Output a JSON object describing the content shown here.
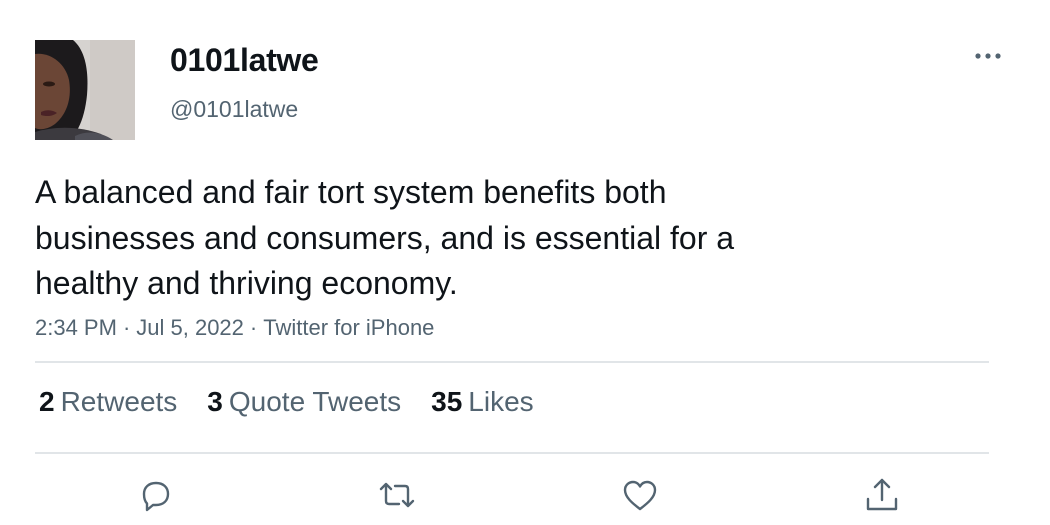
{
  "user": {
    "display_name": "0101latwe",
    "handle": "@0101latwe"
  },
  "tweet": {
    "text": "A balanced and fair tort system benefits both businesses and consumers, and is essential for a healthy and thriving economy.",
    "time": "2:34 PM",
    "date": "Jul 5, 2022",
    "source": "Twitter for iPhone",
    "separator": "·"
  },
  "stats": {
    "retweets_count": "2",
    "retweets_label": "Retweets",
    "quotes_count": "3",
    "quotes_label": "Quote Tweets",
    "likes_count": "35",
    "likes_label": "Likes"
  },
  "icons": {
    "more": "more-horizontal-icon",
    "reply": "reply-icon",
    "retweet": "retweet-icon",
    "like": "heart-icon",
    "share": "share-icon"
  },
  "colors": {
    "text_primary": "#0f1419",
    "text_secondary": "#536471",
    "divider": "#e1e5e8",
    "icon": "#536471"
  }
}
